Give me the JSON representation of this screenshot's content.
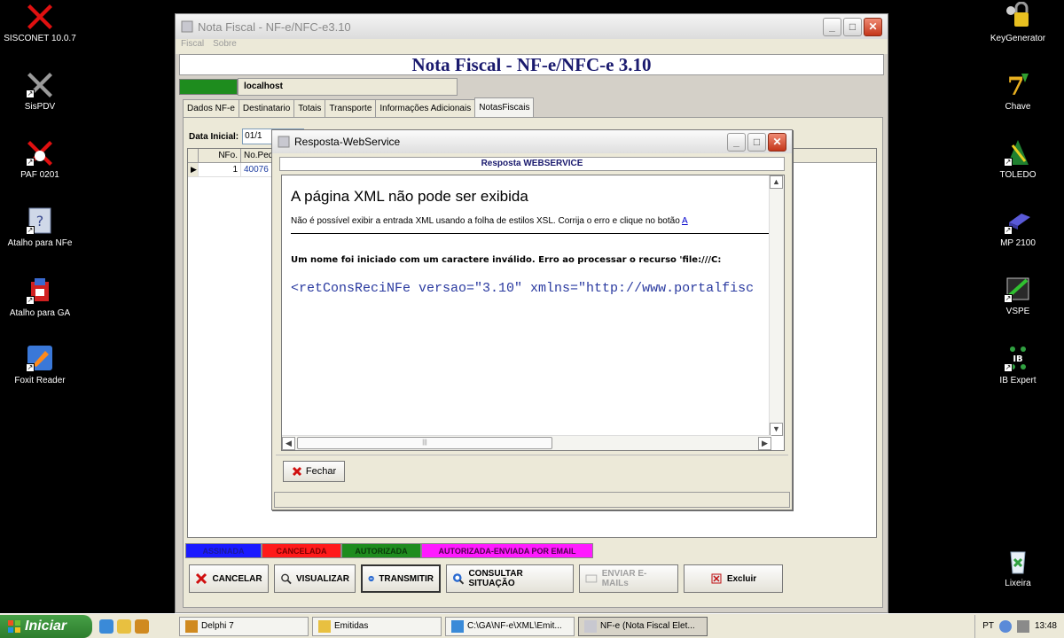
{
  "desktop": {
    "left_icons": [
      {
        "label": "SISCONET 10.0.7",
        "icon": "red-x-icon"
      },
      {
        "label": "SisPDV",
        "icon": "gray-x-icon"
      },
      {
        "label": "PAF 0201",
        "icon": "red-x-icon"
      },
      {
        "label": "Atalho para NFe",
        "icon": "nfe-icon"
      },
      {
        "label": "Atalho para GA",
        "icon": "ga-icon"
      },
      {
        "label": "Foxit Reader",
        "icon": "foxit-icon"
      }
    ],
    "right_icons": [
      {
        "label": "KeyGenerator",
        "icon": "key-icon"
      },
      {
        "label": "Chave",
        "icon": "delphi7-icon"
      },
      {
        "label": "TOLEDO",
        "icon": "toledo-icon"
      },
      {
        "label": "MP 2100",
        "icon": "printer-icon"
      },
      {
        "label": "VSPE",
        "icon": "vspe-icon"
      },
      {
        "label": "IB Expert",
        "icon": "ibexpert-icon"
      },
      {
        "label": "Lixeira",
        "icon": "recycle-bin-icon"
      }
    ]
  },
  "main_window": {
    "title": "Nota Fiscal - NF-e/NFC-e3.10",
    "menu": [
      "Fiscal",
      "Sobre"
    ],
    "banner": "Nota Fiscal - NF-e/NFC-e 3.10",
    "host": "localhost",
    "tabs": [
      "Dados NF-e",
      "Destinatario",
      "Totais",
      "Transporte",
      "Informações Adicionais",
      "NotasFiscais"
    ],
    "active_tab": "NotasFiscais",
    "filter": {
      "label": "Data Inicial:",
      "value": "01/1"
    },
    "grid": {
      "columns": [
        "NFo.",
        "No.Ped"
      ],
      "rows": [
        [
          "1",
          "40076"
        ]
      ]
    },
    "legend": [
      {
        "label": "ASSINADA",
        "bg": "#1a1aff",
        "fg": "#1a1a9a"
      },
      {
        "label": "CANCELADA",
        "bg": "#ff1a1a",
        "fg": "#7a0000"
      },
      {
        "label": "AUTORIZADA",
        "bg": "#1e8c1e",
        "fg": "#0a3a0a"
      },
      {
        "label": "AUTORIZADA-ENVIADA POR EMAIL",
        "bg": "#ff1aff",
        "fg": "#4a004a"
      }
    ],
    "buttons": [
      {
        "label": "CANCELAR",
        "icon": "red-x-icon",
        "enabled": true
      },
      {
        "label": "VISUALIZAR",
        "icon": "magnifier-icon",
        "enabled": true
      },
      {
        "label": "TRANSMITIR",
        "icon": "transmit-icon",
        "enabled": true
      },
      {
        "label": "CONSULTAR SITUAÇÃO",
        "icon": "search-globe-icon",
        "enabled": true
      },
      {
        "label": "ENVIAR E-MAILs",
        "icon": "email-icon",
        "enabled": false
      },
      {
        "label": "Excluir",
        "icon": "delete-icon",
        "enabled": true
      }
    ]
  },
  "dialog": {
    "title": "Resposta-WebService",
    "header": "Resposta WEBSERVICE",
    "xml_title": "A página XML não pode ser exibida",
    "xml_desc": "Não é possível exibir a entrada XML usando a folha de estilos XSL. Corrija o erro e clique no botão",
    "xml_desc_link": "A",
    "xml_error": "Um nome foi iniciado com um caractere inválido. Erro ao processar o recurso 'file:///C:",
    "xml_code": "<retConsReciNFe versao=\"3.10\" xmlns=\"http://www.portalfisc",
    "close_button": "Fechar"
  },
  "taskbar": {
    "start": "Iniciar",
    "tasks": [
      {
        "label": "Delphi 7",
        "active": false
      },
      {
        "label": "Emitidas",
        "active": false
      },
      {
        "label": "C:\\GA\\NF-e\\XML\\Emit...",
        "active": false
      },
      {
        "label": "NF-e (Nota Fiscal Elet...",
        "active": true
      }
    ],
    "lang": "PT",
    "time": "13:48"
  }
}
